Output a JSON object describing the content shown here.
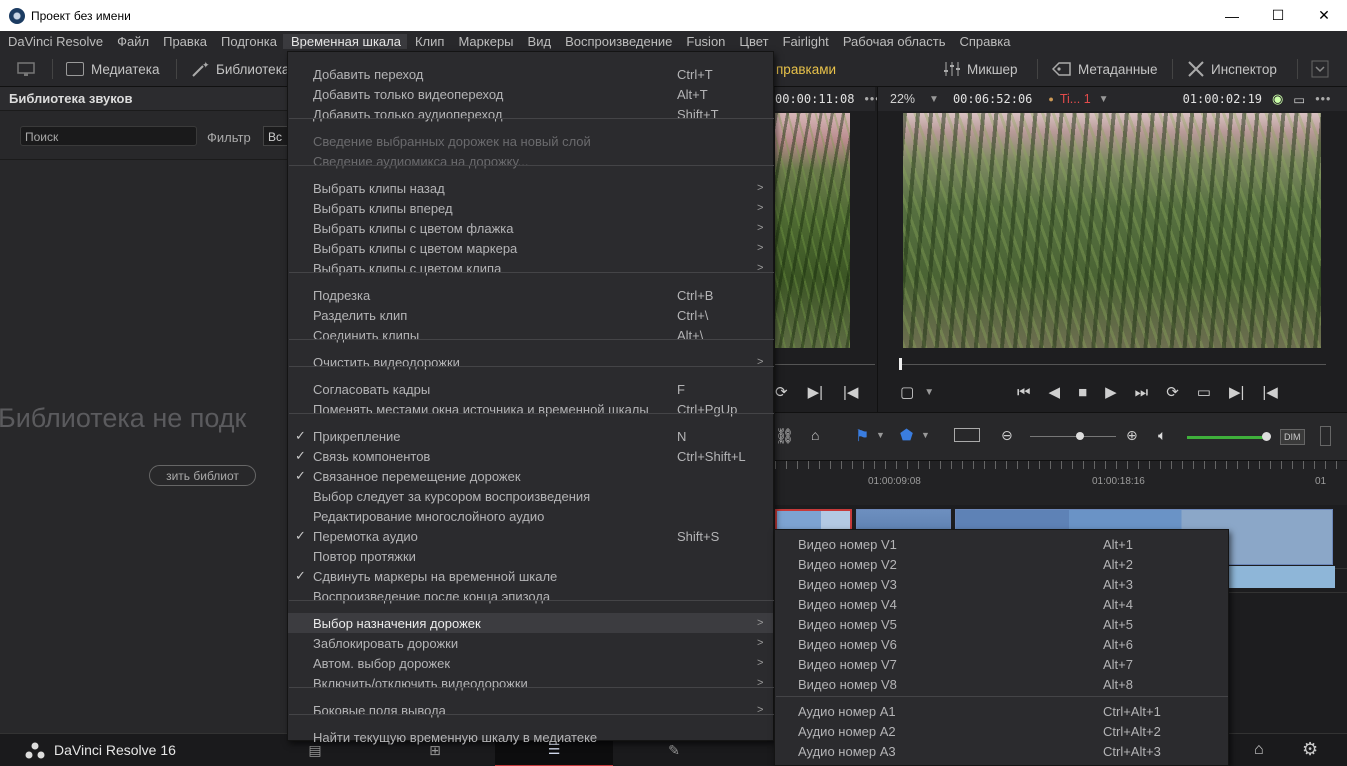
{
  "window": {
    "title": "Проект без имени",
    "controls": {
      "minimize": "—",
      "maximize": "☐",
      "close": "✕"
    }
  },
  "menubar": [
    "DaVinci Resolve",
    "Файл",
    "Правка",
    "Подгонка",
    "Временная шкала",
    "Клип",
    "Маркеры",
    "Вид",
    "Воспроизведение",
    "Fusion",
    "Цвет",
    "Fairlight",
    "Рабочая область",
    "Справка"
  ],
  "toolbar": {
    "media": "Медиатека",
    "library": "Библиотека",
    "edits": "правками",
    "mixer": "Микшер",
    "metadata": "Метаданные",
    "inspector": "Инспектор"
  },
  "sound_library": {
    "header": "Библиотека звуков",
    "search_placeholder": "Поиск",
    "filter_label": "Фильтр",
    "filter_value": "Вс",
    "empty_text": "Библиотека не подк",
    "connect_button": "зить библиот"
  },
  "source_viewer": {
    "timecode": "00:00:11:08",
    "menu": "•••"
  },
  "timeline_viewer": {
    "zoom": "22%",
    "duration": "00:06:52:06",
    "timeline_name": "Ti... 1",
    "timecode": "01:00:02:19",
    "menu": "•••"
  },
  "ruler": {
    "labels": [
      "01:00:09:08",
      "01:00:18:16",
      "01"
    ]
  },
  "timeline_toolbar": {
    "dim": "DIM"
  },
  "bottombar": {
    "app_name": "DaVinci Resolve 16"
  },
  "timeline_menu": {
    "items": [
      {
        "label": "Добавить переход",
        "shortcut": "Ctrl+T",
        "check": "",
        "arrow": "",
        "state": "normal"
      },
      {
        "label": "Добавить только видеопереход",
        "shortcut": "Alt+T",
        "check": "",
        "arrow": "",
        "state": "normal"
      },
      {
        "label": "Добавить только аудиопереход",
        "shortcut": "Shift+T",
        "check": "",
        "arrow": "",
        "state": "normal"
      },
      {
        "label": "Сведение выбранных дорожек на новый слой",
        "shortcut": "",
        "check": "",
        "arrow": "",
        "state": "disabled"
      },
      {
        "label": "Сведение аудиомикса на дорожку...",
        "shortcut": "",
        "check": "",
        "arrow": "",
        "state": "disabled"
      },
      {
        "label": "Выбрать клипы назад",
        "shortcut": "",
        "check": "",
        "arrow": ">",
        "state": "normal"
      },
      {
        "label": "Выбрать клипы вперед",
        "shortcut": "",
        "check": "",
        "arrow": ">",
        "state": "normal"
      },
      {
        "label": "Выбрать клипы с цветом флажка",
        "shortcut": "",
        "check": "",
        "arrow": ">",
        "state": "normal"
      },
      {
        "label": "Выбрать клипы с цветом маркера",
        "shortcut": "",
        "check": "",
        "arrow": ">",
        "state": "normal"
      },
      {
        "label": "Выбрать клипы с цветом клипа",
        "shortcut": "",
        "check": "",
        "arrow": ">",
        "state": "normal"
      },
      {
        "label": "Подрезка",
        "shortcut": "Ctrl+B",
        "check": "",
        "arrow": "",
        "state": "normal"
      },
      {
        "label": "Разделить клип",
        "shortcut": "Ctrl+\\",
        "check": "",
        "arrow": "",
        "state": "normal"
      },
      {
        "label": "Соединить клипы",
        "shortcut": "Alt+\\",
        "check": "",
        "arrow": "",
        "state": "normal"
      },
      {
        "label": "Очистить видеодорожки",
        "shortcut": "",
        "check": "",
        "arrow": ">",
        "state": "normal"
      },
      {
        "label": "Согласовать кадры",
        "shortcut": "F",
        "check": "",
        "arrow": "",
        "state": "normal"
      },
      {
        "label": "Поменять местами окна источника и временной шкалы",
        "shortcut": "Ctrl+PgUp",
        "check": "",
        "arrow": "",
        "state": "normal"
      },
      {
        "label": "Прикрепление",
        "shortcut": "N",
        "check": "✓",
        "arrow": "",
        "state": "normal"
      },
      {
        "label": "Связь компонентов",
        "shortcut": "Ctrl+Shift+L",
        "check": "✓",
        "arrow": "",
        "state": "normal"
      },
      {
        "label": "Связанное перемещение дорожек",
        "shortcut": "",
        "check": "✓",
        "arrow": "",
        "state": "normal"
      },
      {
        "label": "Выбор следует за курсором воспроизведения",
        "shortcut": "",
        "check": "",
        "arrow": "",
        "state": "normal"
      },
      {
        "label": "Редактирование многослойного аудио",
        "shortcut": "",
        "check": "",
        "arrow": "",
        "state": "normal"
      },
      {
        "label": "Перемотка аудио",
        "shortcut": "Shift+S",
        "check": "✓",
        "arrow": "",
        "state": "normal"
      },
      {
        "label": "Повтор протяжки",
        "shortcut": "",
        "check": "",
        "arrow": "",
        "state": "normal"
      },
      {
        "label": "Сдвинуть маркеры на временной шкале",
        "shortcut": "",
        "check": "✓",
        "arrow": "",
        "state": "normal"
      },
      {
        "label": "Воспроизведение после конца эпизода",
        "shortcut": "",
        "check": "",
        "arrow": "",
        "state": "normal"
      },
      {
        "label": "Выбор назначения дорожек",
        "shortcut": "",
        "check": "",
        "arrow": ">",
        "state": "highlight"
      },
      {
        "label": "Заблокировать дорожки",
        "shortcut": "",
        "check": "",
        "arrow": ">",
        "state": "normal"
      },
      {
        "label": "Автом. выбор дорожек",
        "shortcut": "",
        "check": "",
        "arrow": ">",
        "state": "normal"
      },
      {
        "label": "Включить/отключить видеодорожки",
        "shortcut": "",
        "check": "",
        "arrow": ">",
        "state": "normal"
      },
      {
        "label": "Боковые поля вывода",
        "shortcut": "",
        "check": "",
        "arrow": ">",
        "state": "normal"
      },
      {
        "label": "Найти текущую временную шкалу в медиатеке",
        "shortcut": "",
        "check": "",
        "arrow": "",
        "state": "normal"
      }
    ]
  },
  "track_dest_submenu": {
    "items": [
      {
        "label": "Видео номер V1",
        "shortcut": "Alt+1"
      },
      {
        "label": "Видео номер V2",
        "shortcut": "Alt+2"
      },
      {
        "label": "Видео номер V3",
        "shortcut": "Alt+3"
      },
      {
        "label": "Видео номер V4",
        "shortcut": "Alt+4"
      },
      {
        "label": "Видео номер V5",
        "shortcut": "Alt+5"
      },
      {
        "label": "Видео номер V6",
        "shortcut": "Alt+6"
      },
      {
        "label": "Видео номер V7",
        "shortcut": "Alt+7"
      },
      {
        "label": "Видео номер V8",
        "shortcut": "Alt+8"
      },
      {
        "label": "Аудио номер A1",
        "shortcut": "Ctrl+Alt+1"
      },
      {
        "label": "Аудио номер A2",
        "shortcut": "Ctrl+Alt+2"
      },
      {
        "label": "Аудио номер A3",
        "shortcut": "Ctrl+Alt+3"
      }
    ]
  }
}
